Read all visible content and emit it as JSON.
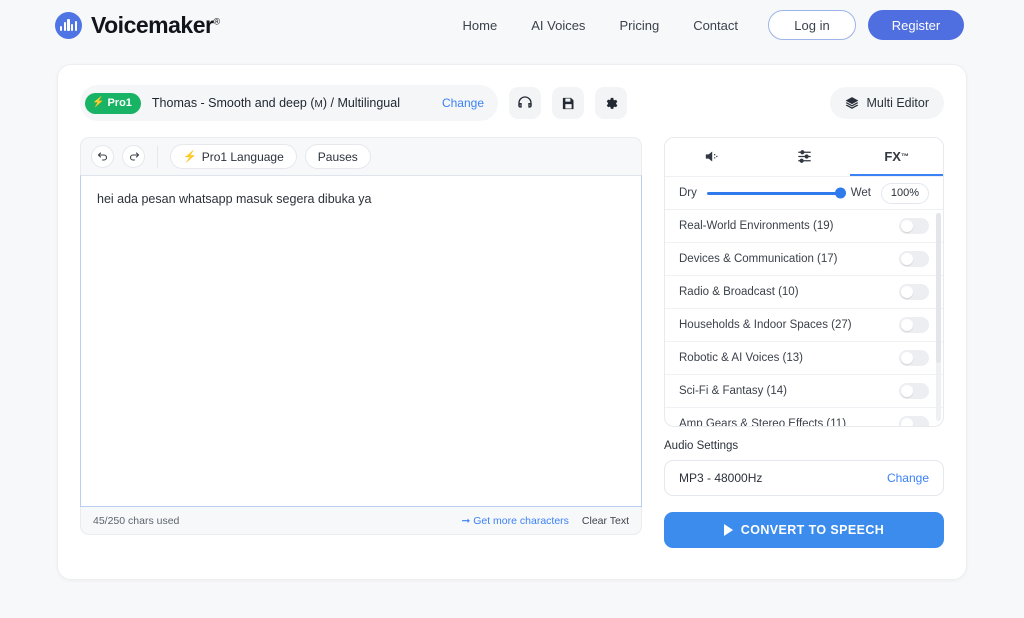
{
  "header": {
    "brand": "Voicemaker",
    "brand_registered": "®",
    "nav": [
      {
        "label": "Home"
      },
      {
        "label": "AI Voices"
      },
      {
        "label": "Pricing"
      },
      {
        "label": "Contact"
      }
    ],
    "login_label": "Log in",
    "register_label": "Register",
    "accent_color": "#4f6fe0"
  },
  "voice_bar": {
    "badge_label": "Pro1",
    "badge_color": "#18b364",
    "voice_name_main": "Thomas - Smooth and deep (",
    "voice_gender": "M",
    "voice_name_rest": ") / Multilingual",
    "change_label": "Change",
    "icons": [
      {
        "name": "headphones-icon"
      },
      {
        "name": "save-icon"
      },
      {
        "name": "settings-gear-icon"
      }
    ],
    "multi_editor_label": "Multi Editor"
  },
  "editor": {
    "toolbar": {
      "undo_label": "↺",
      "redo_label": "↻",
      "pro_language_label": "Pro1 Language",
      "pauses_label": "Pauses"
    },
    "text": "hei ada pesan whatsapp masuk segera dibuka ya",
    "footer": {
      "chars_used": "45/250 chars used",
      "get_more_label": "➞ Get more characters",
      "clear_text_label": "Clear Text"
    }
  },
  "side_panel": {
    "tabs": [
      {
        "label": "",
        "icon": "speaker-volume-icon",
        "active": false
      },
      {
        "label": "",
        "icon": "equalizer-sliders-icon",
        "active": false
      },
      {
        "label": "FX",
        "sup": "™",
        "icon": "fx-icon",
        "active": true
      }
    ],
    "dry_wet": {
      "dry_label": "Dry",
      "wet_label": "Wet",
      "percent": "100%",
      "slider_value": 100,
      "accent_color": "#2f7bed"
    },
    "fx_categories": [
      {
        "label": "Real-World Environments (19)",
        "enabled": false
      },
      {
        "label": "Devices & Communication (17)",
        "enabled": false
      },
      {
        "label": "Radio & Broadcast (10)",
        "enabled": false
      },
      {
        "label": "Households & Indoor Spaces (27)",
        "enabled": false
      },
      {
        "label": "Robotic & AI Voices (13)",
        "enabled": false
      },
      {
        "label": "Sci-Fi & Fantasy (14)",
        "enabled": false
      },
      {
        "label": "Amp Gears & Stereo Effects (11)",
        "enabled": false
      }
    ],
    "audio_settings": {
      "title": "Audio Settings",
      "value": "MP3 - 48000Hz",
      "change_label": "Change"
    },
    "convert_label": "CONVERT TO SPEECH",
    "convert_color": "#3b8ced"
  }
}
